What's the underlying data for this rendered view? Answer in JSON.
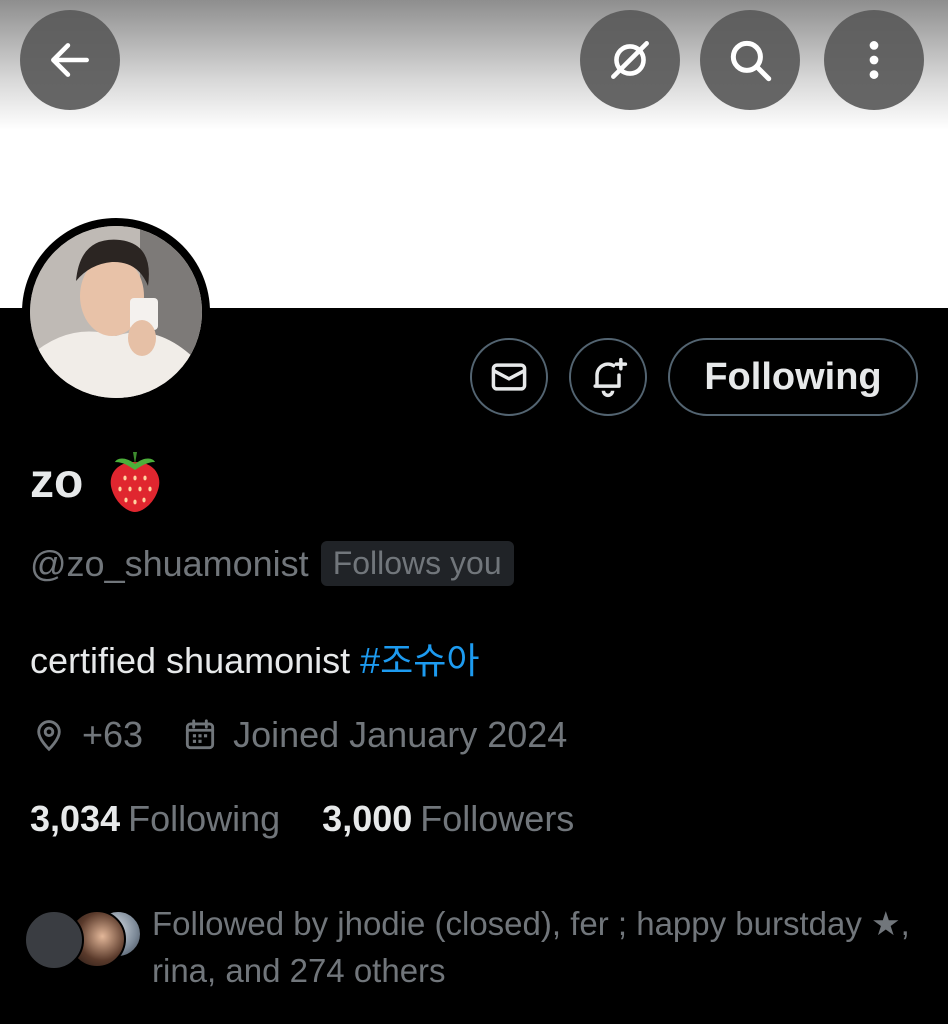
{
  "profile": {
    "display_name": "zo",
    "handle": "@zo_shuamonist",
    "follows_you_badge": "Follows you",
    "bio_text": "certified shuamonist ",
    "bio_hashtag": "#조슈아",
    "location": "+63",
    "joined": "Joined January 2024",
    "following_count": "3,034",
    "following_label": "Following",
    "followers_count": "3,000",
    "followers_label": "Followers",
    "followed_by_text": "Followed by jhodie (closed), fer ; happy burstday ★, rina, and 274 others"
  },
  "actions": {
    "following_button_label": "Following"
  },
  "icons": {
    "back": "back-arrow-icon",
    "grok": "grok-icon",
    "search": "search-icon",
    "more": "more-vertical-icon",
    "message": "mail-icon",
    "notify": "bell-plus-icon",
    "location": "location-pin-icon",
    "calendar": "calendar-icon",
    "emoji": "strawberry-emoji"
  },
  "colors": {
    "background": "#000000",
    "text_primary": "#e7e9ea",
    "text_secondary": "#71767b",
    "accent_link": "#1d9bf0",
    "border": "#536471"
  }
}
